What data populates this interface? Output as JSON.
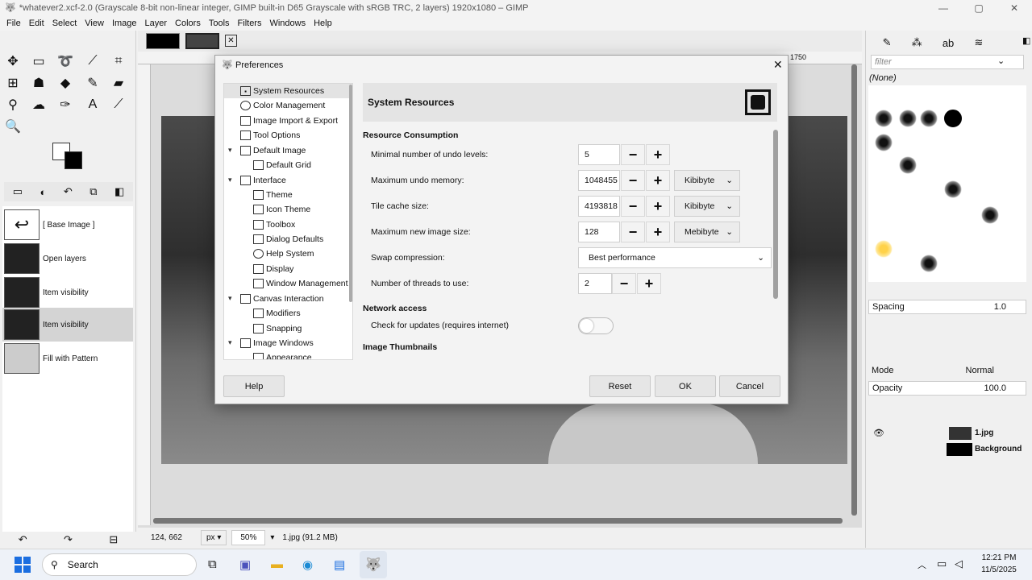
{
  "window": {
    "title": "*whatever2.xcf-2.0 (Grayscale 8-bit non-linear integer, GIMP built-in D65 Grayscale with sRGB TRC, 2 layers) 1920x1080 – GIMP"
  },
  "menubar": [
    "File",
    "Edit",
    "Select",
    "View",
    "Image",
    "Layer",
    "Colors",
    "Tools",
    "Filters",
    "Windows",
    "Help"
  ],
  "history": {
    "items": [
      "[ Base Image ]",
      "Open layers",
      "Item visibility",
      "Item visibility",
      "Fill with Pattern"
    ]
  },
  "statusbar": {
    "coords": "124, 662",
    "unit": "px",
    "zoom": "50%",
    "file": "1.jpg (91.2 MB)"
  },
  "right": {
    "filter_placeholder": "filter",
    "brush_selected": "(None)",
    "spacing_label": "Spacing",
    "spacing_value": "1.0",
    "mode_label": "Mode",
    "mode_value": "Normal",
    "opacity_label": "Opacity",
    "opacity_value": "100.0",
    "layers": [
      "1.jpg",
      "Background"
    ]
  },
  "ruler": {
    "top_right": "1750"
  },
  "dialog": {
    "title": "Preferences",
    "tree": [
      "System Resources",
      "Color Management",
      "Image Import & Export",
      "Tool Options",
      "Default Image",
      "Default Grid",
      "Interface",
      "Theme",
      "Icon Theme",
      "Toolbox",
      "Dialog Defaults",
      "Help System",
      "Display",
      "Window Management",
      "Canvas Interaction",
      "Modifiers",
      "Snapping",
      "Image Windows",
      "Appearance"
    ],
    "page_title": "System Resources",
    "section_resource": "Resource Consumption",
    "undo_levels_label": "Minimal number of undo levels:",
    "undo_levels": "5",
    "undo_memory_label": "Maximum undo memory:",
    "undo_memory": "1048455",
    "undo_memory_unit": "Kibibyte",
    "tile_cache_label": "Tile cache size:",
    "tile_cache": "4193818",
    "tile_cache_unit": "Kibibyte",
    "max_image_label": "Maximum new image size:",
    "max_image": "128",
    "max_image_unit": "Mebibyte",
    "swap_label": "Swap compression:",
    "swap_value": "Best performance",
    "threads_label": "Number of threads to use:",
    "threads": "2",
    "section_network": "Network access",
    "updates_label": "Check for updates (requires internet)",
    "section_thumbs": "Image Thumbnails",
    "help": "Help",
    "reset": "Reset",
    "ok": "OK",
    "cancel": "Cancel"
  },
  "taskbar": {
    "search": "Search",
    "time": "12:21 PM",
    "date": "11/5/2025"
  }
}
